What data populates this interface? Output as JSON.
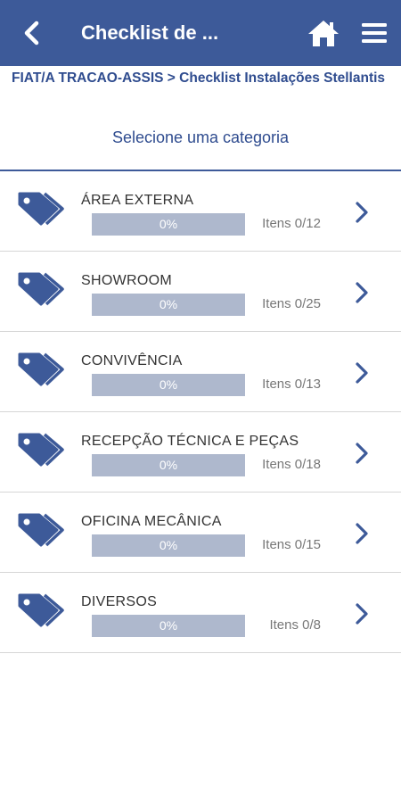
{
  "header": {
    "title": "Checklist de ...",
    "back_icon": "chevron-left-icon",
    "home_icon": "home-icon",
    "menu_icon": "hamburger-menu-icon"
  },
  "breadcrumb": "FIAT/A TRACAO-ASSIS > Checklist Instalações Stellantis",
  "subtitle": "Selecione uma categoria",
  "colors": {
    "primary": "#3d5a99",
    "bar_track": "#aeb8cd",
    "text_dark": "#333333"
  },
  "categories": [
    {
      "name": "ÁREA EXTERNA",
      "percent": "0%",
      "progress": 0,
      "count": "Itens 0/12"
    },
    {
      "name": "SHOWROOM",
      "percent": "0%",
      "progress": 0,
      "count": "Itens 0/25"
    },
    {
      "name": "CONVIVÊNCIA",
      "percent": "0%",
      "progress": 0,
      "count": "Itens 0/13"
    },
    {
      "name": "RECEPÇÃO TÉCNICA E PEÇAS",
      "percent": "0%",
      "progress": 0,
      "count": "Itens 0/18"
    },
    {
      "name": "OFICINA MECÂNICA",
      "percent": "0%",
      "progress": 0,
      "count": "Itens 0/15"
    },
    {
      "name": "DIVERSOS",
      "percent": "0%",
      "progress": 0,
      "count": "Itens 0/8"
    }
  ]
}
